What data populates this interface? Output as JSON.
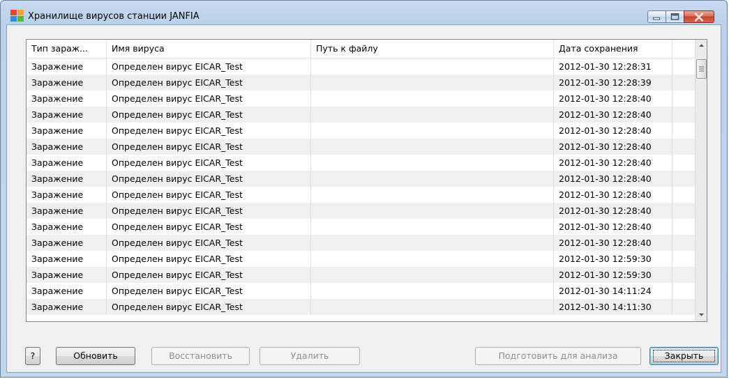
{
  "window": {
    "title": "Хранилище вирусов станции JANFIA"
  },
  "table": {
    "columns": [
      "Тип зараж...",
      "Имя вируса",
      "Путь к файлу",
      "Дата сохранения",
      ""
    ],
    "rows": [
      {
        "type": "Заражение",
        "name": "Определен вирус EICAR_Test",
        "path": "",
        "date": "2012-01-30 12:28:31"
      },
      {
        "type": "Заражение",
        "name": "Определен вирус EICAR_Test",
        "path": "",
        "date": "2012-01-30 12:28:39"
      },
      {
        "type": "Заражение",
        "name": "Определен вирус EICAR_Test",
        "path": "",
        "date": "2012-01-30 12:28:40"
      },
      {
        "type": "Заражение",
        "name": "Определен вирус EICAR_Test",
        "path": "",
        "date": "2012-01-30 12:28:40"
      },
      {
        "type": "Заражение",
        "name": "Определен вирус EICAR_Test",
        "path": "",
        "date": "2012-01-30 12:28:40"
      },
      {
        "type": "Заражение",
        "name": "Определен вирус EICAR_Test",
        "path": "",
        "date": "2012-01-30 12:28:40"
      },
      {
        "type": "Заражение",
        "name": "Определен вирус EICAR_Test",
        "path": "",
        "date": "2012-01-30 12:28:40"
      },
      {
        "type": "Заражение",
        "name": "Определен вирус EICAR_Test",
        "path": "",
        "date": "2012-01-30 12:28:40"
      },
      {
        "type": "Заражение",
        "name": "Определен вирус EICAR_Test",
        "path": "",
        "date": "2012-01-30 12:28:40"
      },
      {
        "type": "Заражение",
        "name": "Определен вирус EICAR_Test",
        "path": "",
        "date": "2012-01-30 12:28:40"
      },
      {
        "type": "Заражение",
        "name": "Определен вирус EICAR_Test",
        "path": "",
        "date": "2012-01-30 12:28:40"
      },
      {
        "type": "Заражение",
        "name": "Определен вирус EICAR_Test",
        "path": "",
        "date": "2012-01-30 12:28:40"
      },
      {
        "type": "Заражение",
        "name": "Определен вирус EICAR_Test",
        "path": "",
        "date": "2012-01-30 12:59:30"
      },
      {
        "type": "Заражение",
        "name": "Определен вирус EICAR_Test",
        "path": "",
        "date": "2012-01-30 12:59:30"
      },
      {
        "type": "Заражение",
        "name": "Определен вирус EICAR_Test",
        "path": "",
        "date": "2012-01-30 14:11:24"
      },
      {
        "type": "Заражение",
        "name": "Определен вирус EICAR_Test",
        "path": "",
        "date": "2012-01-30 14:11:30"
      }
    ]
  },
  "buttons": {
    "help": "?",
    "refresh": "Обновить",
    "restore": "Восстановить",
    "delete": "Удалить",
    "prepare": "Подготовить для анализа",
    "close": "Закрыть"
  },
  "colors": {
    "title_bar": "#c9daf0",
    "close_button": "#c2412b",
    "client_background": "#f0f0f0",
    "alt_row": "#f0f0f0"
  },
  "icons": {
    "app": "avg-logo-icon",
    "minimize": "minimize-icon",
    "maximize": "maximize-icon",
    "close": "close-icon",
    "scroll_up": "scroll-up-arrow-icon",
    "scroll_down": "scroll-down-arrow-icon"
  }
}
